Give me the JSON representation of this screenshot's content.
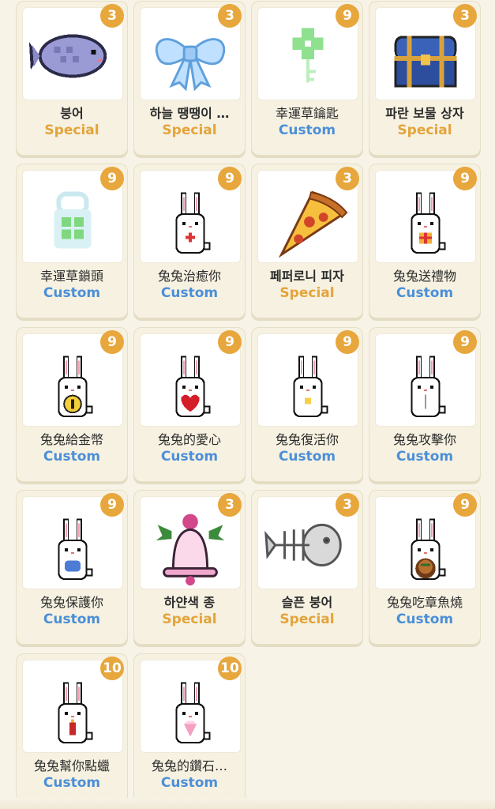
{
  "items": [
    {
      "name": "붕어",
      "type": "Special",
      "count": "3",
      "icon": "taiyaki-fish-icon",
      "bold": true
    },
    {
      "name": "하늘 땡땡이 …",
      "type": "Special",
      "count": "3",
      "icon": "blue-ribbon-bow-icon",
      "bold": true
    },
    {
      "name": "幸運草鑰匙",
      "type": "Custom",
      "count": "9",
      "icon": "clover-key-icon",
      "bold": false
    },
    {
      "name": "파란 보물 상자",
      "type": "Special",
      "count": "3",
      "icon": "blue-treasure-chest-icon",
      "bold": true
    },
    {
      "name": "幸運草鎖頭",
      "type": "Custom",
      "count": "9",
      "icon": "clover-padlock-icon",
      "bold": false
    },
    {
      "name": "兔兔治癒你",
      "type": "Custom",
      "count": "9",
      "icon": "bunny-heal-icon",
      "bold": false
    },
    {
      "name": "페퍼로니 피자",
      "type": "Special",
      "count": "3",
      "icon": "pepperoni-pizza-icon",
      "bold": true
    },
    {
      "name": "兔兔送禮物",
      "type": "Custom",
      "count": "9",
      "icon": "bunny-gift-icon",
      "bold": false
    },
    {
      "name": "兔兔給金幣",
      "type": "Custom",
      "count": "9",
      "icon": "bunny-coin-icon",
      "bold": false
    },
    {
      "name": "兔兔的愛心",
      "type": "Custom",
      "count": "9",
      "icon": "bunny-heart-icon",
      "bold": false
    },
    {
      "name": "兔兔復活你",
      "type": "Custom",
      "count": "9",
      "icon": "bunny-revive-icon",
      "bold": false
    },
    {
      "name": "兔兔攻擊你",
      "type": "Custom",
      "count": "9",
      "icon": "bunny-attack-icon",
      "bold": false
    },
    {
      "name": "兔兔保護你",
      "type": "Custom",
      "count": "9",
      "icon": "bunny-shield-icon",
      "bold": false
    },
    {
      "name": "하얀색 종",
      "type": "Special",
      "count": "3",
      "icon": "white-bell-icon",
      "bold": true
    },
    {
      "name": "슬픈 붕어",
      "type": "Special",
      "count": "3",
      "icon": "fish-skeleton-icon",
      "bold": true
    },
    {
      "name": "兔兔吃章魚燒",
      "type": "Custom",
      "count": "9",
      "icon": "bunny-takoyaki-icon",
      "bold": false
    },
    {
      "name": "兔兔幫你點蠟",
      "type": "Custom",
      "count": "10",
      "icon": "bunny-candle-icon",
      "bold": false
    },
    {
      "name": "兔兔的鑽石…",
      "type": "Custom",
      "count": "10",
      "icon": "bunny-diamond-icon",
      "bold": false
    }
  ],
  "colors": {
    "special": "#e4a43b",
    "custom": "#4b8fd8",
    "badge": "#e7a73d",
    "background": "#f7f3e6"
  }
}
